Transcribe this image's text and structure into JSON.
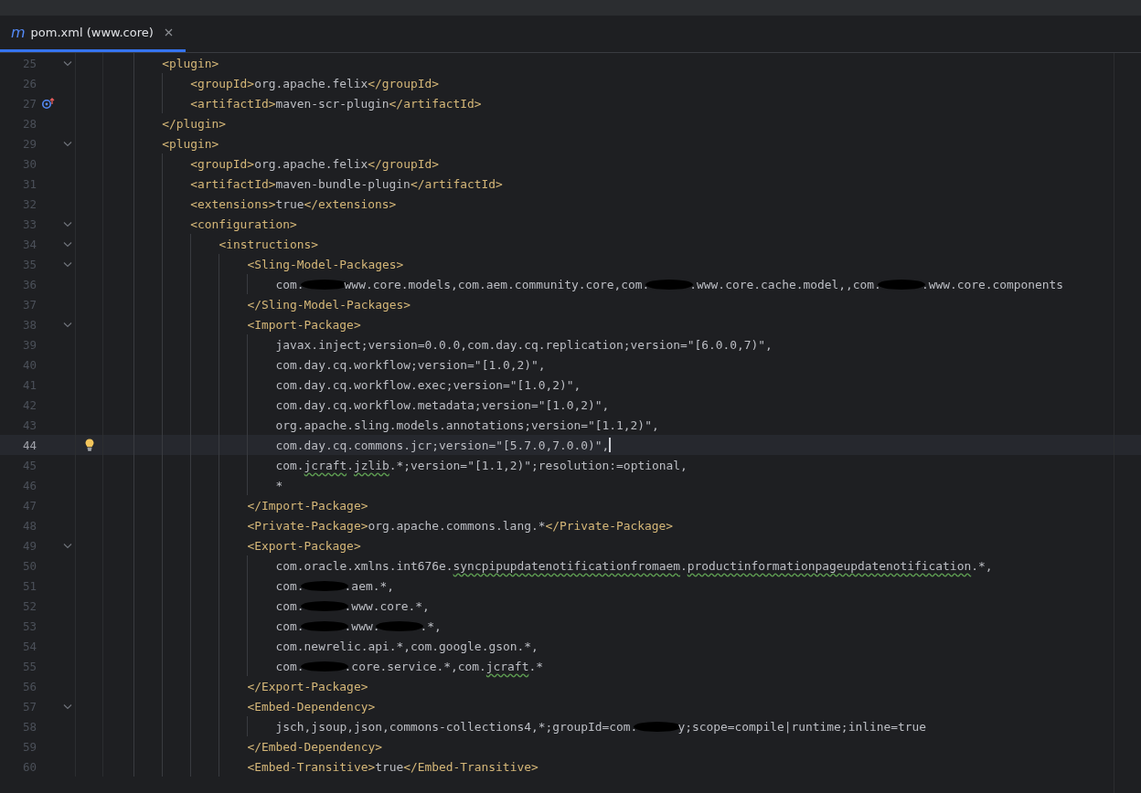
{
  "tab": {
    "icon": "m",
    "label": "pom.xml (www.core)",
    "selected": true
  },
  "lines": [
    {
      "number": "25",
      "current": false,
      "expanded": true,
      "tokens": [
        {
          "kind": "tag",
          "text": "<plugin>"
        }
      ],
      "children": [
        {
          "number": "26",
          "current": false,
          "tokens": [
            {
              "kind": "tag",
              "text": "<groupId>"
            },
            {
              "kind": "text",
              "text": "org.apache.felix"
            },
            {
              "kind": "tag",
              "text": "</groupId>"
            }
          ]
        },
        {
          "number": "27",
          "current": false,
          "gutter": {
            "kind": "override"
          },
          "tokens": [
            {
              "kind": "tag",
              "text": "<artifactId>"
            },
            {
              "kind": "text",
              "text": "maven-scr-plugin"
            },
            {
              "kind": "tag",
              "text": "</artifactId>"
            }
          ]
        }
      ]
    },
    {
      "number": "28",
      "current": false,
      "tokens": [
        {
          "kind": "tag",
          "text": "</plugin>"
        }
      ]
    },
    {
      "number": "29",
      "current": false,
      "expanded": true,
      "tokens": [
        {
          "kind": "tag",
          "text": "<plugin>"
        }
      ],
      "children": [
        {
          "number": "30",
          "current": false,
          "tokens": [
            {
              "kind": "tag",
              "text": "<groupId>"
            },
            {
              "kind": "text",
              "text": "org.apache.felix"
            },
            {
              "kind": "tag",
              "text": "</groupId>"
            }
          ]
        },
        {
          "number": "31",
          "current": false,
          "tokens": [
            {
              "kind": "tag",
              "text": "<artifactId>"
            },
            {
              "kind": "text",
              "text": "maven-bundle-plugin"
            },
            {
              "kind": "tag",
              "text": "</artifactId>"
            }
          ]
        },
        {
          "number": "32",
          "current": false,
          "tokens": [
            {
              "kind": "tag",
              "text": "<extensions>"
            },
            {
              "kind": "text",
              "text": "true"
            },
            {
              "kind": "tag",
              "text": "</extensions>"
            }
          ]
        },
        {
          "number": "33",
          "current": false,
          "expanded": true,
          "tokens": [
            {
              "kind": "tag",
              "text": "<configuration>"
            }
          ],
          "children": [
            {
              "number": "34",
              "current": false,
              "expanded": true,
              "tokens": [
                {
                  "kind": "tag",
                  "text": "<instructions>"
                }
              ],
              "children": [
                {
                  "number": "35",
                  "current": false,
                  "expanded": true,
                  "tokens": [
                    {
                      "kind": "tag",
                      "text": "<Sling-Model-Packages>"
                    }
                  ],
                  "children": [
                    {
                      "number": "36",
                      "current": false,
                      "tokens": [
                        {
                          "kind": "text",
                          "text": "com."
                        },
                        {
                          "kind": "redacted"
                        },
                        {
                          "kind": "text",
                          "text": "www.core.models,com.aem.community.core,com."
                        },
                        {
                          "kind": "redacted"
                        },
                        {
                          "kind": "text",
                          "text": ".www.core.cache.model,,com."
                        },
                        {
                          "kind": "redacted"
                        },
                        {
                          "kind": "text",
                          "text": ".www.core.components"
                        }
                      ]
                    }
                  ]
                },
                {
                  "number": "37",
                  "current": false,
                  "tokens": [
                    {
                      "kind": "tag",
                      "text": "</Sling-Model-Packages>"
                    }
                  ]
                },
                {
                  "number": "38",
                  "current": false,
                  "expanded": true,
                  "tokens": [
                    {
                      "kind": "tag",
                      "text": "<Import-Package>"
                    }
                  ],
                  "children": [
                    {
                      "number": "39",
                      "current": false,
                      "tokens": [
                        {
                          "kind": "text",
                          "text": "javax.inject;version=0.0.0,com.day.cq.replication;version=\"[6.0.0,7)\","
                        }
                      ]
                    },
                    {
                      "number": "40",
                      "current": false,
                      "tokens": [
                        {
                          "kind": "text",
                          "text": "com.day.cq.workflow;version=\"[1.0,2)\","
                        }
                      ]
                    },
                    {
                      "number": "41",
                      "current": false,
                      "tokens": [
                        {
                          "kind": "text",
                          "text": "com.day.cq.workflow.exec;version=\"[1.0,2)\","
                        }
                      ]
                    },
                    {
                      "number": "42",
                      "current": false,
                      "tokens": [
                        {
                          "kind": "text",
                          "text": "com.day.cq.workflow.metadata;version=\"[1.0,2)\","
                        }
                      ]
                    },
                    {
                      "number": "43",
                      "current": false,
                      "tokens": [
                        {
                          "kind": "text",
                          "text": "org.apache.sling.models.annotations;version=\"[1.1,2)\","
                        }
                      ]
                    },
                    {
                      "number": "44",
                      "current": true,
                      "gutter": {
                        "kind": "bulb"
                      },
                      "tokens": [
                        {
                          "kind": "text",
                          "text": "com.day.cq.commons.jcr;version=\"[5.7.0,7.0.0)\","
                        }
                      ]
                    },
                    {
                      "number": "45",
                      "current": false,
                      "tokens": [
                        {
                          "kind": "text",
                          "text": "com."
                        },
                        {
                          "kind": "typo",
                          "text": "jcraft"
                        },
                        {
                          "kind": "text",
                          "text": "."
                        },
                        {
                          "kind": "typo",
                          "text": "jzlib"
                        },
                        {
                          "kind": "text",
                          "text": ".*;version=\"[1.1,2)\";resolution:=optional,"
                        }
                      ]
                    },
                    {
                      "number": "46",
                      "current": false,
                      "tokens": [
                        {
                          "kind": "text",
                          "text": "*"
                        }
                      ]
                    }
                  ]
                },
                {
                  "number": "47",
                  "current": false,
                  "tokens": [
                    {
                      "kind": "tag",
                      "text": "</Import-Package>"
                    }
                  ]
                },
                {
                  "number": "48",
                  "current": false,
                  "tokens": [
                    {
                      "kind": "tag",
                      "text": "<Private-Package>"
                    },
                    {
                      "kind": "text",
                      "text": "org.apache.commons.lang.*"
                    },
                    {
                      "kind": "tag",
                      "text": "</Private-Package>"
                    }
                  ]
                },
                {
                  "number": "49",
                  "current": false,
                  "expanded": true,
                  "tokens": [
                    {
                      "kind": "tag",
                      "text": "<Export-Package>"
                    }
                  ],
                  "children": [
                    {
                      "number": "50",
                      "current": false,
                      "tokens": [
                        {
                          "kind": "text",
                          "text": "com.oracle.xmlns.int676e."
                        },
                        {
                          "kind": "typo",
                          "text": "syncpipupdatenotificationfromaem"
                        },
                        {
                          "kind": "text",
                          "text": "."
                        },
                        {
                          "kind": "typo",
                          "text": "productinformationpageupdatenotification"
                        },
                        {
                          "kind": "text",
                          "text": ".*,"
                        }
                      ]
                    },
                    {
                      "number": "51",
                      "current": false,
                      "tokens": [
                        {
                          "kind": "text",
                          "text": "com."
                        },
                        {
                          "kind": "redacted"
                        },
                        {
                          "kind": "text",
                          "text": ".aem.*,"
                        }
                      ]
                    },
                    {
                      "number": "52",
                      "current": false,
                      "tokens": [
                        {
                          "kind": "text",
                          "text": "com."
                        },
                        {
                          "kind": "redacted"
                        },
                        {
                          "kind": "text",
                          "text": ".www.core.*,"
                        }
                      ]
                    },
                    {
                      "number": "53",
                      "current": false,
                      "tokens": [
                        {
                          "kind": "text",
                          "text": "com."
                        },
                        {
                          "kind": "redacted"
                        },
                        {
                          "kind": "text",
                          "text": ".www."
                        },
                        {
                          "kind": "redacted"
                        },
                        {
                          "kind": "text",
                          "text": ".*,"
                        }
                      ]
                    },
                    {
                      "number": "54",
                      "current": false,
                      "tokens": [
                        {
                          "kind": "text",
                          "text": "com.newrelic.api.*,com.google.gson.*,"
                        }
                      ]
                    },
                    {
                      "number": "55",
                      "current": false,
                      "tokens": [
                        {
                          "kind": "text",
                          "text": "com."
                        },
                        {
                          "kind": "redacted"
                        },
                        {
                          "kind": "text",
                          "text": ".core.service.*,com."
                        },
                        {
                          "kind": "typo",
                          "text": "jcraft"
                        },
                        {
                          "kind": "text",
                          "text": ".*"
                        }
                      ]
                    }
                  ]
                },
                {
                  "number": "56",
                  "current": false,
                  "tokens": [
                    {
                      "kind": "tag",
                      "text": "</Export-Package>"
                    }
                  ]
                },
                {
                  "number": "57",
                  "current": false,
                  "expanded": true,
                  "tokens": [
                    {
                      "kind": "tag",
                      "text": "<Embed-Dependency>"
                    }
                  ],
                  "children": [
                    {
                      "number": "58",
                      "current": false,
                      "tokens": [
                        {
                          "kind": "text",
                          "text": "jsch,jsoup,json,commons-collections4,*;groupId=com."
                        },
                        {
                          "kind": "redacted"
                        },
                        {
                          "kind": "text",
                          "text": "y;scope=compile|runtime;inline=true"
                        }
                      ]
                    }
                  ]
                },
                {
                  "number": "59",
                  "current": false,
                  "tokens": [
                    {
                      "kind": "tag",
                      "text": "</Embed-Dependency>"
                    }
                  ]
                },
                {
                  "number": "60",
                  "current": false,
                  "tokens": [
                    {
                      "kind": "tag",
                      "text": "<Embed-Transitive>"
                    },
                    {
                      "kind": "text",
                      "text": "true"
                    },
                    {
                      "kind": "tag",
                      "text": "</Embed-Transitive>"
                    }
                  ]
                }
              ]
            }
          ]
        }
      ]
    }
  ]
}
